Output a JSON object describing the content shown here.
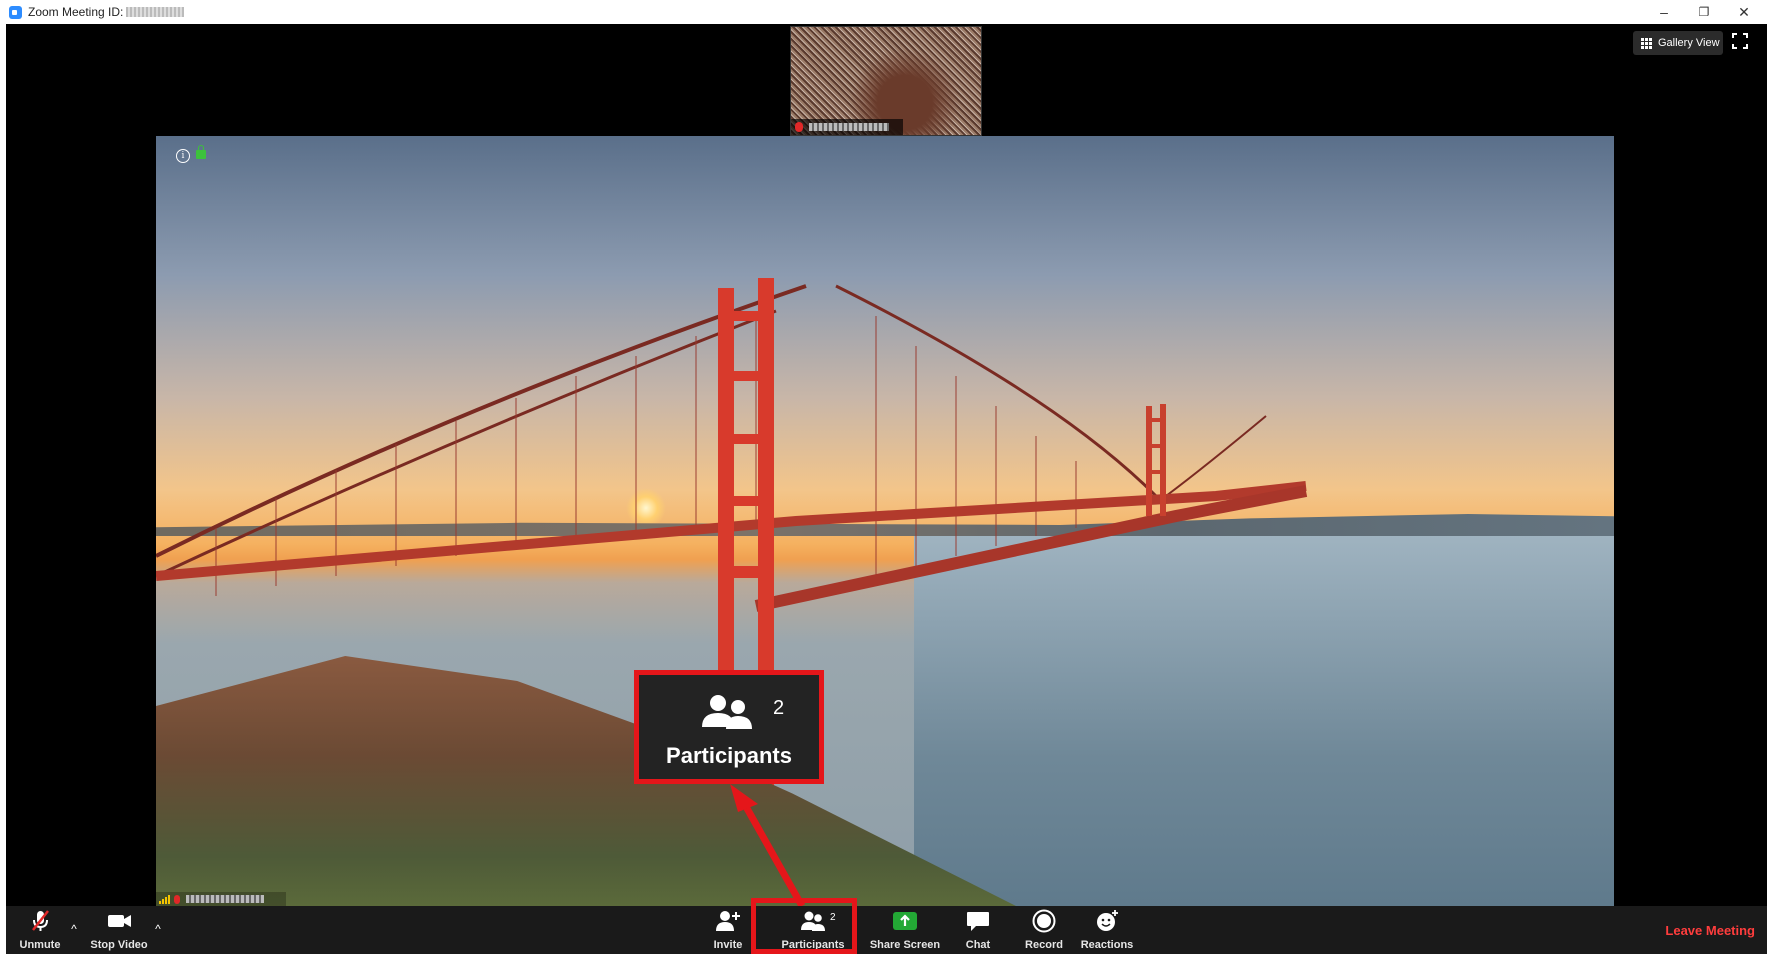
{
  "titlebar": {
    "title": "Zoom Meeting ID:",
    "minimize_glyph": "–",
    "restore_glyph": "❐",
    "close_glyph": "✕"
  },
  "meeting": {
    "gallery_view_label": "Gallery View"
  },
  "callout": {
    "count": "2",
    "label": "Participants"
  },
  "toolbar": {
    "unmute_label": "Unmute",
    "stop_video_label": "Stop Video",
    "invite_label": "Invite",
    "participants_label": "Participants",
    "participants_count": "2",
    "share_screen_label": "Share Screen",
    "chat_label": "Chat",
    "record_label": "Record",
    "reactions_label": "Reactions",
    "leave_label": "Leave Meeting"
  },
  "colors": {
    "highlight": "#e5161a",
    "share_green": "#23a835",
    "leave_red": "#ff3d3d",
    "toolbar_bg": "#1a1a1a"
  },
  "icons": [
    "zoom-app-icon",
    "info-icon",
    "lock-icon",
    "grid-icon",
    "fullscreen-icon",
    "mic-muted-icon",
    "video-camera-icon",
    "invite-icon",
    "participants-icon",
    "share-screen-icon",
    "chat-icon",
    "record-icon",
    "reactions-icon"
  ]
}
